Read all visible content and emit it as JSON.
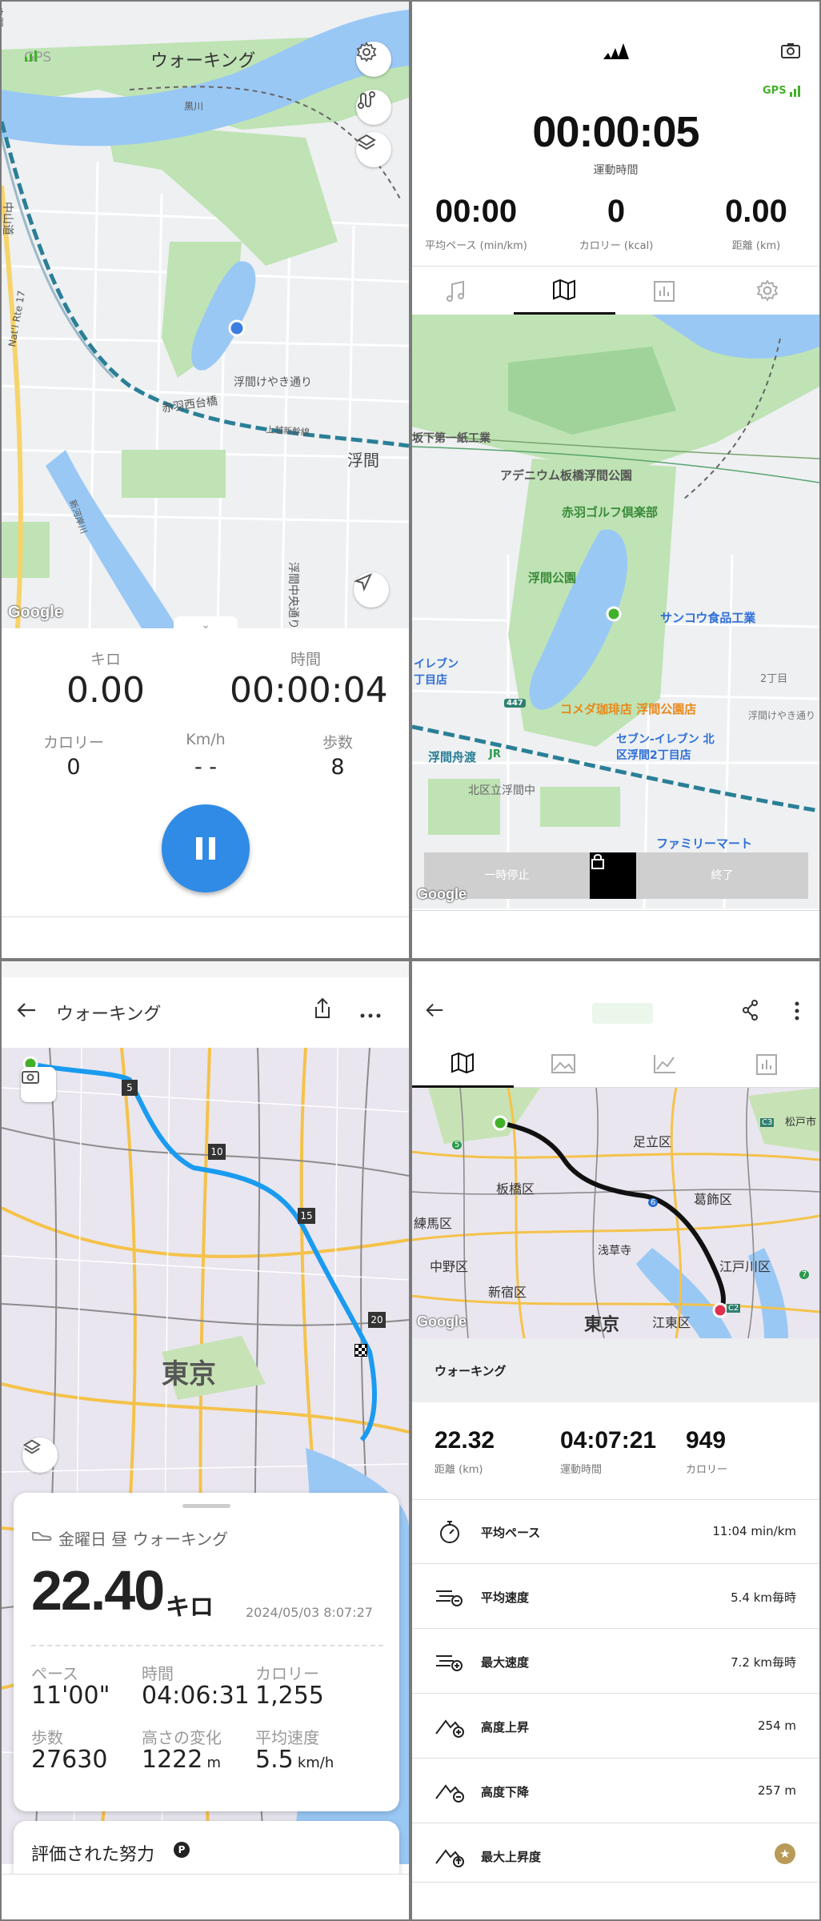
{
  "p1": {
    "gps": "GPS",
    "mode_title": "ウォーキング",
    "map_labels": [
      "赤羽西台橋",
      "浮間けやき通り",
      "浮間",
      "浮間中央通り",
      "中山道",
      "Nat'l Rte 17",
      "黒川",
      "上越新幹線",
      "新河岸川",
      "赤羽"
    ],
    "google": "Google",
    "stats": {
      "km_label": "キロ",
      "km_value": "0.00",
      "time_label": "時間",
      "time_value": "00:00:04",
      "cal_label": "カロリー",
      "cal_value": "0",
      "speed_label": "Km/h",
      "speed_value": "- -",
      "steps_label": "歩数",
      "steps_value": "8"
    }
  },
  "p2": {
    "gps": "GPS",
    "elapsed": "00:00:05",
    "elapsed_label": "運動時間",
    "pace_value": "00:00",
    "pace_label": "平均ペース (min/km)",
    "cal_value": "0",
    "cal_label": "カロリー (kcal)",
    "dist_value": "0.00",
    "dist_label": "距離 (km)",
    "map_labels": {
      "l1": "坂下第一紙工業",
      "l2": "アデニウム板橋浮間公園",
      "l3": "赤羽ゴルフ倶楽部",
      "l4": "浮間公園",
      "l5": "サンコウ食品工業",
      "l6": "イレブン",
      "l7": "丁目店",
      "l8": "コメダ珈琲店 浮間公園店",
      "l9": "セブン-イレブン 北",
      "l10": "区浮間2丁目店",
      "l11": "浮間舟渡",
      "l12": "JR",
      "l13": "北区立浮間中",
      "l14": "2丁目",
      "l15": "浮間けやき通り",
      "l16": "ファミリーマート",
      "l17": "447"
    },
    "pause_label": "一時停止",
    "end_label": "終了",
    "google": "Google"
  },
  "p3": {
    "title": "ウォーキング",
    "km_markers": [
      "5",
      "10",
      "15",
      "20"
    ],
    "city_label": "東京",
    "card_subtitle": "金曜日 昼 ウォーキング",
    "distance": "22.40",
    "distance_unit": "キロ",
    "datetime": "2024/05/03 8:07:27",
    "pace_label": "ペース",
    "pace_value": "11'00\"",
    "time_label": "時間",
    "time_value": "04:06:31",
    "cal_label": "カロリー",
    "cal_value": "1,255",
    "steps_label": "歩数",
    "steps_value": "27630",
    "elev_label": "高さの変化",
    "elev_value": "1222",
    "elev_unit": "m",
    "avgspeed_label": "平均速度",
    "avgspeed_value": "5.5",
    "avgspeed_unit": "km/h",
    "effort_label": "評価された努力"
  },
  "p4": {
    "map_labels": {
      "a": "足立区",
      "b": "板橋区",
      "c": "葛飾区",
      "d": "練馬区",
      "e": "浅草寺",
      "f": "中野区",
      "g": "江戸川区",
      "h": "新宿区",
      "i": "東京",
      "j": "江東区",
      "k": "松戸市",
      "m1": "C2",
      "m2": "C3",
      "m3": "5",
      "m4": "6",
      "m5": "7"
    },
    "google": "Google",
    "section_title": "ウォーキング",
    "dist_value": "22.32",
    "dist_label": "距離 (km)",
    "time_value": "04:07:21",
    "time_label": "運動時間",
    "cal_value": "949",
    "cal_label": "カロリー",
    "rows": [
      {
        "label": "平均ペース",
        "value": "11:04 min/km"
      },
      {
        "label": "平均速度",
        "value": "5.4 km毎時"
      },
      {
        "label": "最大速度",
        "value": "7.2 km毎時"
      },
      {
        "label": "高度上昇",
        "value": "254 m"
      },
      {
        "label": "高度下降",
        "value": "257 m"
      },
      {
        "label": "最大上昇度",
        "value": ""
      }
    ]
  },
  "colors": {
    "accent_blue": "#2f8be6",
    "route_blue": "#1a9bf0",
    "map_water": "#9ac8f5",
    "map_park": "#bfe3b4",
    "gps_green": "#43b02a"
  }
}
